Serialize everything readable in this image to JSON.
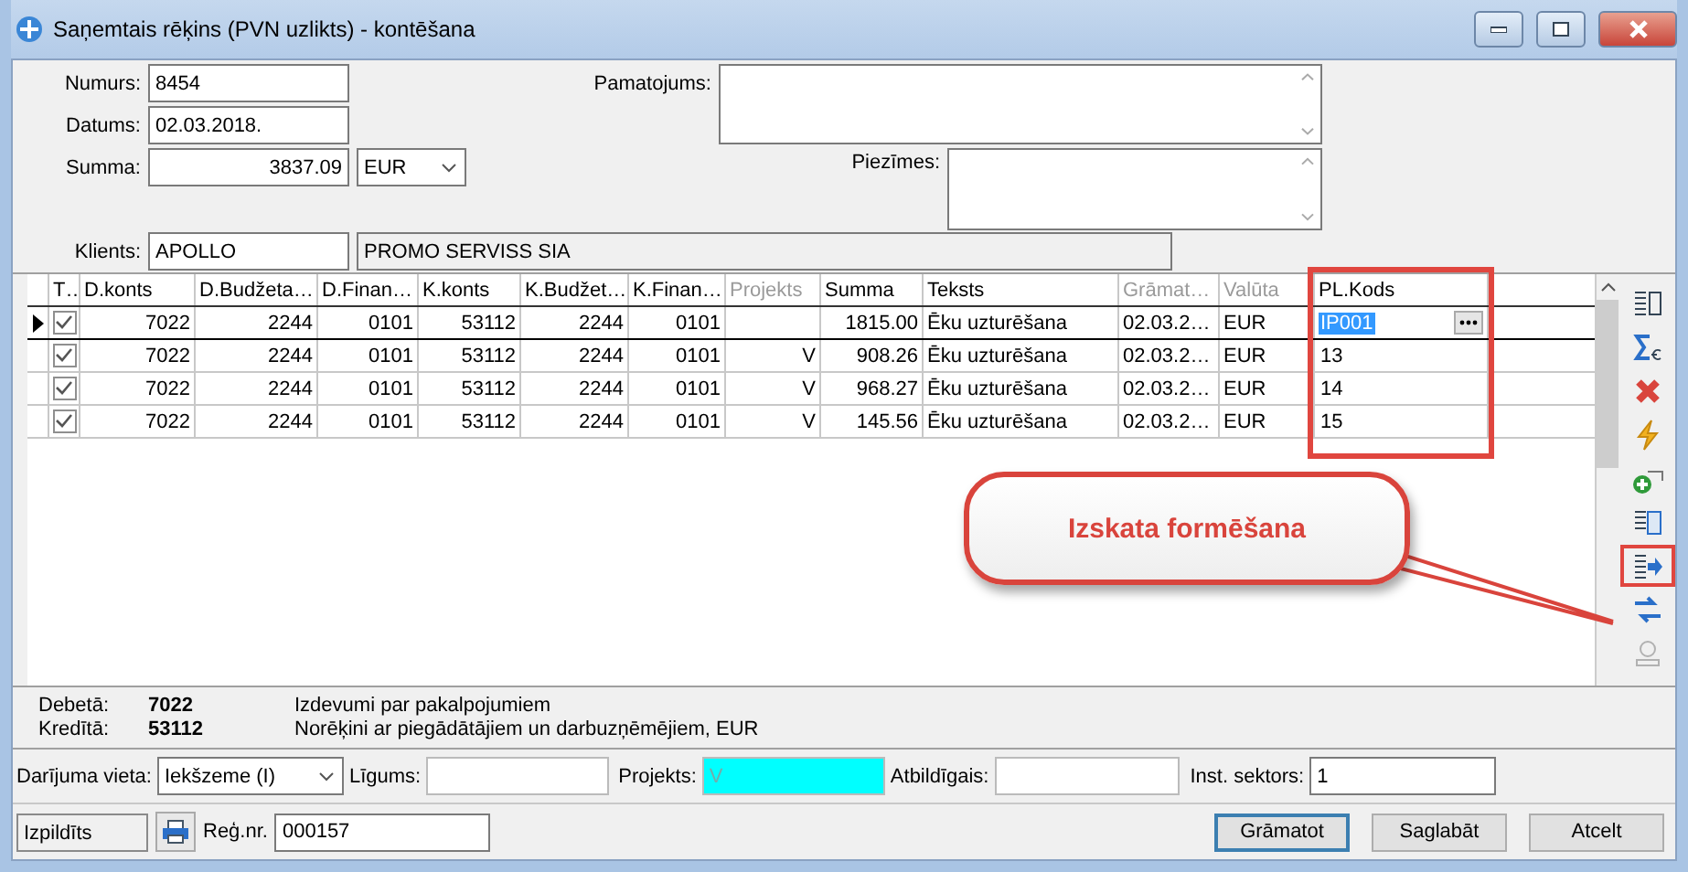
{
  "window": {
    "title": "Saņemtais rēķins (PVN uzlikts) - kontēšana"
  },
  "form": {
    "numurs": {
      "label": "Numurs:",
      "value": "8454"
    },
    "datums": {
      "label": "Datums:",
      "value": "02.03.2018."
    },
    "summa": {
      "label": "Summa:",
      "value": "3837.09",
      "currency": "EUR"
    },
    "pamatojums": {
      "label": "Pamatojums:"
    },
    "piezimes": {
      "label": "Piezīmes:"
    },
    "klients": {
      "label": "Klients:",
      "code": "APOLLO",
      "name": "PROMO SERVISS SIA"
    }
  },
  "table": {
    "columns": [
      {
        "label": "T…",
        "kind": "check",
        "disabled": false,
        "highlighted": false
      },
      {
        "label": "D.konts",
        "kind": "number",
        "disabled": false,
        "highlighted": false
      },
      {
        "label": "D.Budžeta…",
        "kind": "number",
        "disabled": false,
        "highlighted": false
      },
      {
        "label": "D.Finan…",
        "kind": "number",
        "disabled": false,
        "highlighted": false
      },
      {
        "label": "K.konts",
        "kind": "number",
        "disabled": false,
        "highlighted": false
      },
      {
        "label": "K.Budžet…",
        "kind": "number",
        "disabled": false,
        "highlighted": false
      },
      {
        "label": "K.Finan…",
        "kind": "number",
        "disabled": false,
        "highlighted": false
      },
      {
        "label": "Projekts",
        "kind": "number",
        "disabled": true,
        "highlighted": false
      },
      {
        "label": "Summa",
        "kind": "number",
        "disabled": false,
        "highlighted": false
      },
      {
        "label": "Teksts",
        "kind": "text",
        "disabled": false,
        "highlighted": false
      },
      {
        "label": "Grāmat…",
        "kind": "text",
        "disabled": true,
        "highlighted": false
      },
      {
        "label": "Valūta",
        "kind": "text",
        "disabled": true,
        "highlighted": false
      },
      {
        "label": "PL.Kods",
        "kind": "edit",
        "disabled": false,
        "highlighted": true
      }
    ],
    "rows": [
      {
        "selected": true,
        "checked": true,
        "cells": [
          "",
          "7022",
          "2244",
          "0101",
          "53112",
          "2244",
          "0101",
          "",
          "1815.00",
          "Ēku uzturēšana",
          "02.03.2…",
          "EUR",
          "IP001"
        ]
      },
      {
        "selected": false,
        "checked": true,
        "cells": [
          "",
          "7022",
          "2244",
          "0101",
          "53112",
          "2244",
          "0101",
          "V",
          "908.26",
          "Ēku uzturēšana",
          "02.03.2…",
          "EUR",
          "13"
        ]
      },
      {
        "selected": false,
        "checked": true,
        "cells": [
          "",
          "7022",
          "2244",
          "0101",
          "53112",
          "2244",
          "0101",
          "V",
          "968.27",
          "Ēku uzturēšana",
          "02.03.2…",
          "EUR",
          "14"
        ]
      },
      {
        "selected": false,
        "checked": true,
        "cells": [
          "",
          "7022",
          "2244",
          "0101",
          "53112",
          "2244",
          "0101",
          "V",
          "145.56",
          "Ēku uzturēšana",
          "02.03.2…",
          "EUR",
          "15"
        ]
      }
    ]
  },
  "toolbar": [
    {
      "highlighted": false,
      "disabled": false
    },
    {
      "highlighted": false,
      "disabled": false
    },
    {
      "highlighted": false,
      "disabled": false
    },
    {
      "highlighted": false,
      "disabled": false
    },
    {
      "highlighted": false,
      "disabled": false
    },
    {
      "highlighted": false,
      "disabled": false
    },
    {
      "highlighted": true,
      "disabled": false
    },
    {
      "highlighted": false,
      "disabled": false
    },
    {
      "highlighted": false,
      "disabled": true
    }
  ],
  "callout": {
    "text": "Izskata formēšana"
  },
  "accounts": [
    {
      "label": "Debetā:",
      "code": "7022",
      "description": "Izdevumi par pakalpojumiem"
    },
    {
      "label": "Kredītā:",
      "code": "53112",
      "description": "Norēķini ar piegādātājiem un darbuzņēmējiem, EUR"
    }
  ],
  "details": {
    "darijuma_vieta": {
      "label": "Darījuma vieta:",
      "value": "Iekšzeme (I)"
    },
    "ligums": {
      "label": "Līgums:"
    },
    "projekts": {
      "label": "Projekts:",
      "value": "V",
      "highlighted": true
    },
    "atbildigais": {
      "label": "Atbildīgais:"
    },
    "inst_sektors": {
      "label": "Inst. sektors:",
      "value": "1"
    }
  },
  "footer": {
    "status": "Izpildīts",
    "reg_label": "Reģ.nr.",
    "reg_value": "000157",
    "buttons": [
      {
        "label": "Grāmatot",
        "default": true
      },
      {
        "label": "Saglabāt",
        "default": false
      },
      {
        "label": "Atcelt",
        "default": false
      }
    ]
  }
}
